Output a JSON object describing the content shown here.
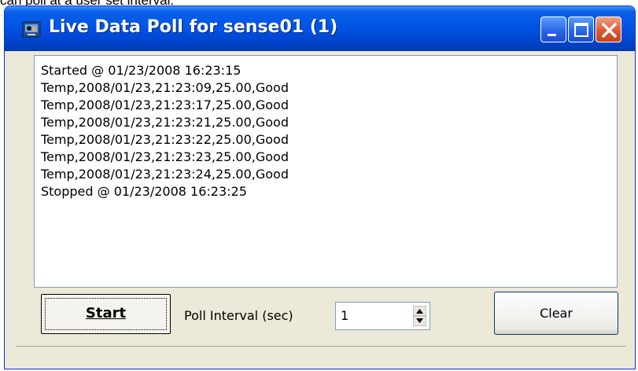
{
  "page_text_above": "can poll at a user set interval.",
  "window": {
    "title": "Live Data Poll for sense01 (1)",
    "title_icon": "sensor-app-icon",
    "controls": [
      "minimize-icon",
      "maximize-icon",
      "close-icon"
    ]
  },
  "log": {
    "lines": [
      "Started @ 01/23/2008 16:23:15",
      "Temp,2008/01/23,21:23:09,25.00,Good",
      "Temp,2008/01/23,21:23:17,25.00,Good",
      "Temp,2008/01/23,21:23:21,25.00,Good",
      "Temp,2008/01/23,21:23:22,25.00,Good",
      "Temp,2008/01/23,21:23:23,25.00,Good",
      "Temp,2008/01/23,21:23:24,25.00,Good",
      "Stopped @ 01/23/2008 16:23:25"
    ]
  },
  "controls": {
    "start_label": "Start",
    "poll_interval_label": "Poll Interval (sec)",
    "poll_interval_value": "1",
    "clear_label": "Clear"
  },
  "colors": {
    "titlebar": "#0055e5",
    "window_bg": "#ece9d8",
    "close_button": "#e0582e"
  }
}
